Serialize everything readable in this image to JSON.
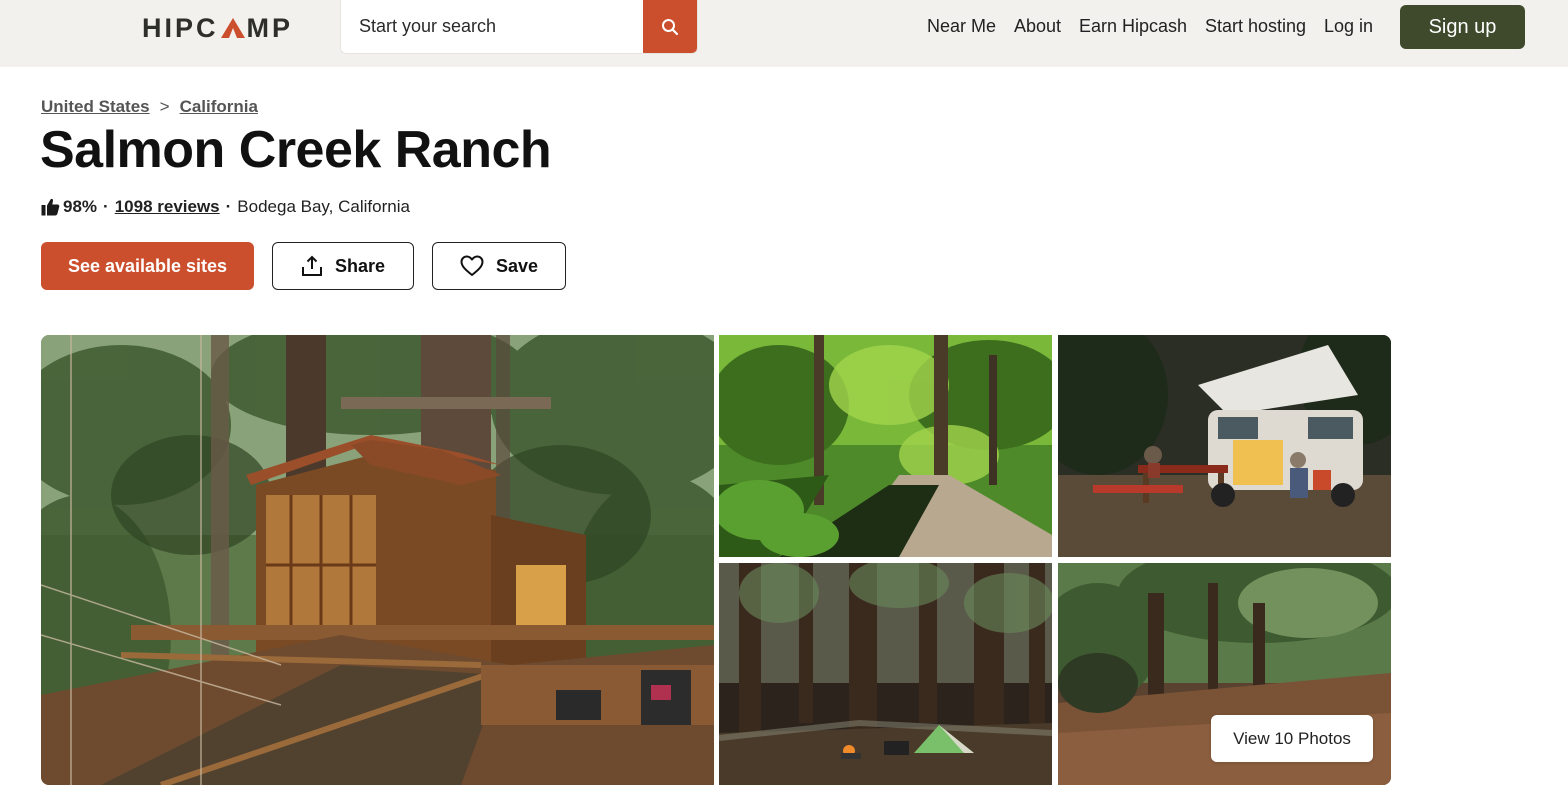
{
  "header": {
    "logo_text_left": "HIPC",
    "logo_text_right": "MP",
    "search_placeholder": "Start your search",
    "nav": [
      "Near Me",
      "About",
      "Earn Hipcash",
      "Start hosting",
      "Log in"
    ],
    "signup_label": "Sign up"
  },
  "breadcrumb": {
    "items": [
      "United States",
      "California"
    ],
    "separator": ">"
  },
  "listing": {
    "title": "Salmon Creek Ranch",
    "rating": "98%",
    "reviews": "1098 reviews",
    "location": "Bodega Bay, California"
  },
  "actions": {
    "primary": "See available sites",
    "share": "Share",
    "save": "Save"
  },
  "gallery": {
    "view_photos_label": "View 10 Photos"
  },
  "colors": {
    "brand_orange": "#cc4f2d",
    "signup_green": "#3f4a2c",
    "header_bg": "#f2f1ee"
  }
}
